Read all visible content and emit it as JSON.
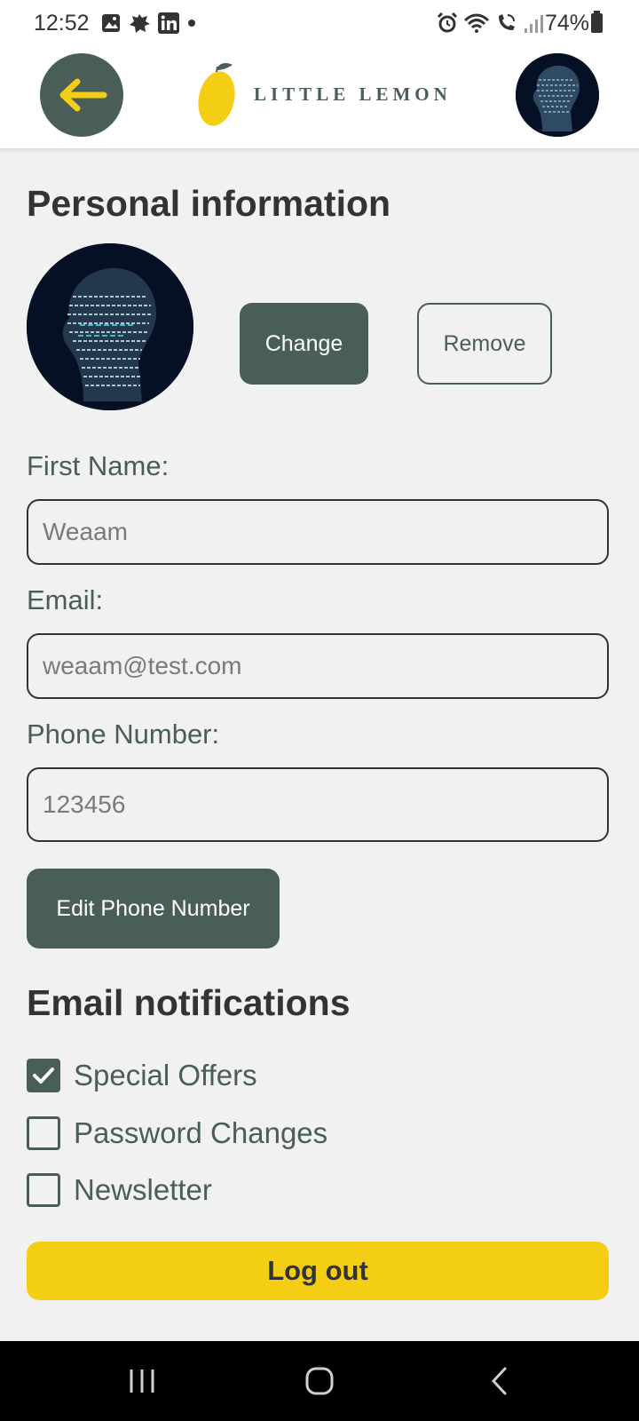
{
  "status_bar": {
    "time": "12:52",
    "battery": "74%",
    "left_icons": [
      "gallery-icon",
      "settings-badge-icon",
      "linkedin-icon",
      "dot-icon"
    ],
    "right_icons": [
      "alarm-icon",
      "wifi-icon",
      "wifi-calling-icon",
      "signal-icon"
    ]
  },
  "header": {
    "back_icon": "arrow-left-icon",
    "logo_text": "LITTLE LEMON",
    "avatar": "profile-avatar"
  },
  "personal": {
    "title": "Personal information",
    "change_label": "Change",
    "remove_label": "Remove"
  },
  "form": {
    "first_name_label": "First Name:",
    "first_name_value": "Weaam",
    "email_label": "Email:",
    "email_value": "weaam@test.com",
    "phone_label": "Phone Number:",
    "phone_value": "123456",
    "edit_phone_label": "Edit Phone Number"
  },
  "notifications": {
    "title": "Email notifications",
    "items": [
      {
        "label": "Special Offers",
        "checked": true
      },
      {
        "label": "Password Changes",
        "checked": false
      },
      {
        "label": "Newsletter",
        "checked": false
      }
    ]
  },
  "logout_label": "Log out",
  "colors": {
    "primary": "#495e57",
    "accent": "#f4ce14",
    "background": "#f1f1f1",
    "text_dark": "#333333"
  },
  "nav": [
    "recent-apps-icon",
    "home-icon",
    "back-icon"
  ]
}
